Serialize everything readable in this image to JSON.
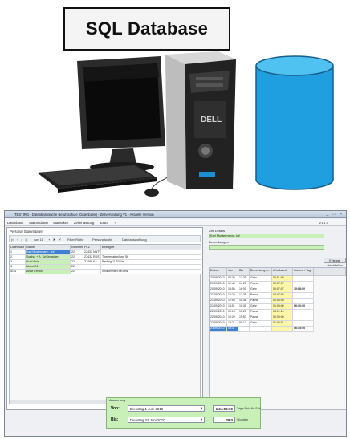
{
  "title_label": "SQL Database",
  "colors": {
    "cylinder": "#1f9fe0",
    "cylinder_top": "#4fc2f2",
    "monitor": "#2b2b2b",
    "tower": "#1e1e1e",
    "green_fill": "#c9f0b8",
    "yellow_fill": "#fff7a8",
    "selection": "#3d7fd1"
  },
  "app": {
    "title": "TESTIRG - Datenbanksuche Berufsschule (Datenbank) - Zeitverwaltung V1 - Aktuelle Version",
    "version": "V1.1.0",
    "window_buttons": "_ □ ×",
    "menu": [
      "Datenbank",
      "Stammdaten",
      "Statistiken",
      "Zeiterfassung",
      "Extra",
      "?"
    ],
    "left_pane": {
      "header": "Personal Stammdaten",
      "toolbar": [
        "|<",
        "<",
        ">",
        ">|",
        "von 11",
        "+",
        "✖",
        "✔",
        "Filter Reihe",
        "Personalwahl",
        "Dateiauswahlung"
      ],
      "columns": [
        "Datensatz",
        "Name",
        "Nummer",
        "PLZ",
        "Bezugort"
      ],
      "rows": [
        {
          "c1": "1",
          "c2": "Karl Mustermann - Inf",
          "c3": "22",
          "c4": "27432 NNTV",
          "c5": ""
        },
        {
          "c1": "2",
          "c2": "Sophia + A. Schümacher",
          "c3": "22",
          "c4": "27432 RDS",
          "c5": "Themenabteilung Str"
        },
        {
          "c1": "3",
          "c2": "Kurt Wolz",
          "c3": "22",
          "c4": "27498 KA",
          "c5": "Berlinig 11 03 4m"
        },
        {
          "c1": "4",
          "c2": "Monu/C1",
          "c3": "22",
          "c4": "",
          "c5": ""
        },
        {
          "c1": "5/14",
          "c2": "Anne Fenton",
          "c3": "22",
          "c4": "",
          "c5": "Willkommen bei uns"
        }
      ]
    },
    "right_pane": {
      "label1": "Zeit Details",
      "field1": "Karl Mustermann - Inf",
      "label2": "Bemerkungen",
      "field2": "",
      "button": "Einträge abschließen",
      "columns": [
        "Datum",
        "Von",
        "Bis",
        "Bemerkung en",
        "Arbeitszeit",
        "Summe / Tag"
      ],
      "rows": [
        {
          "d": "20.09.2010",
          "v": "07:30",
          "b": "12:31",
          "m": "Gehr",
          "a": "05:01:00",
          "s": ""
        },
        {
          "d": "20.09.2010",
          "v": "12:40",
          "b": "14:20",
          "m": "Pause",
          "a": "00:37:07",
          "s": ""
        },
        {
          "d": "20.09.2010",
          "v": "13:54",
          "b": "16:00",
          "m": "Gehr",
          "a": "06:07:07",
          "s": "10:08:00"
        },
        {
          "d": "21.09.2010",
          "v": "15:25",
          "b": "12:38",
          "m": "Pause",
          "a": "05:07:06",
          "s": ""
        },
        {
          "d": "21.09.2010",
          "v": "12:55",
          "b": "15:38",
          "m": "Pause",
          "a": "01:03:00",
          "s": ""
        },
        {
          "d": "21.09.2010",
          "v": "14:51",
          "b": "15:30",
          "m": "Gehr",
          "a": "01:03:00",
          "s": "06:30:00"
        },
        {
          "d": "22.09.2010",
          "v": "09:13",
          "b": "10:20",
          "m": "Pause",
          "a": "08:12:10",
          "s": ""
        },
        {
          "d": "22.09.2010",
          "v": "10:20",
          "b": "15:57",
          "m": "Pause",
          "a": "00:39:00",
          "s": ""
        },
        {
          "d": "22.09.2010",
          "v": "15:21",
          "b": "00:17",
          "m": "Gehr",
          "a": "01:05:01",
          "s": ""
        },
        {
          "d": "23.09.2010",
          "v": "03:31",
          "b": "",
          "m": "",
          "a": "",
          "s": "06:35:00"
        }
      ]
    },
    "filter": {
      "title": "Auswertung",
      "von_label": "Von:",
      "bis_label": "Bis:",
      "von_date": "Dienstag   1   Juni   2010",
      "bis_date": "Dienstag  22   Juni   2010",
      "value1": "1.04:56:00",
      "value2": "29.0",
      "unit1": "Tage:Std:Min:Sek",
      "unit2": "Stunden"
    }
  }
}
